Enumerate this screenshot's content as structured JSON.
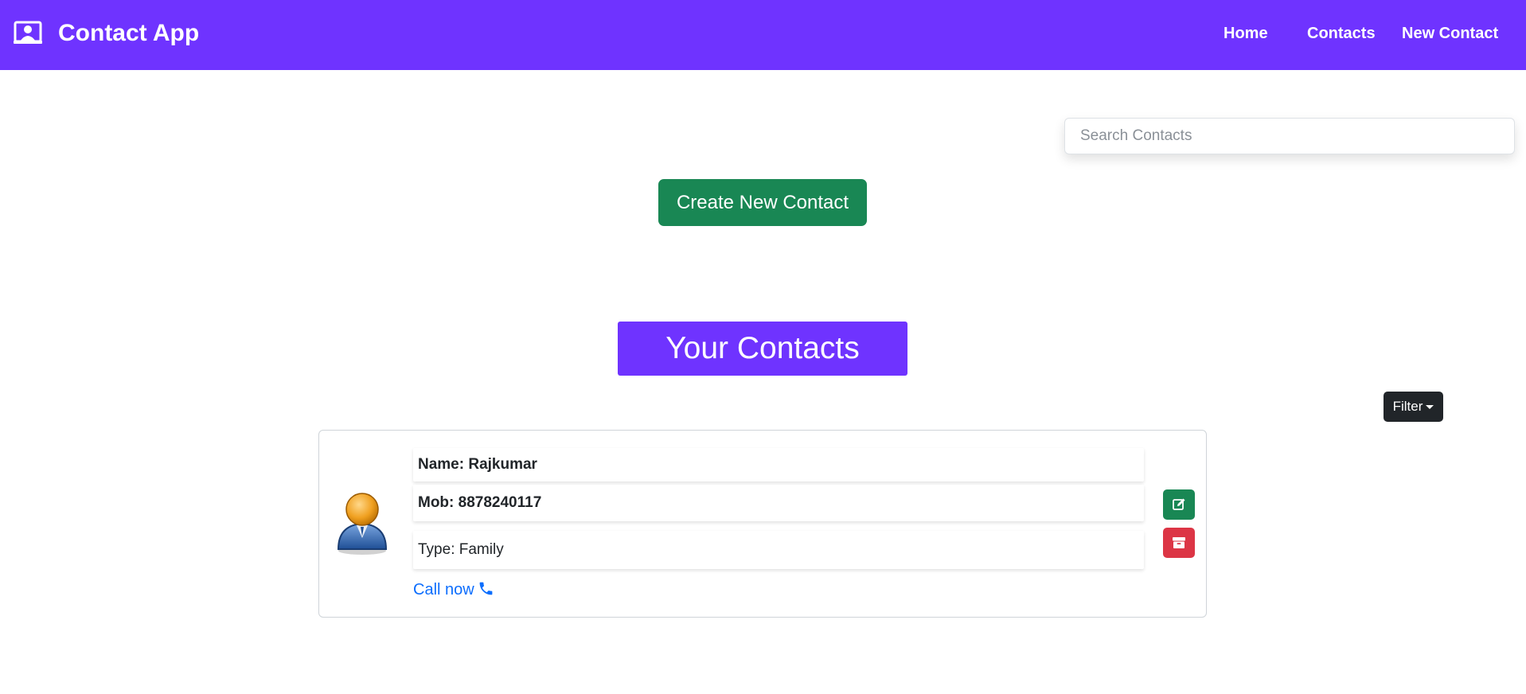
{
  "navbar": {
    "title": "Contact App",
    "brand_icon": "contact-card-icon",
    "links": [
      "Home",
      "Contacts",
      "New Contact"
    ],
    "color": "#6f33ff"
  },
  "search": {
    "placeholder": "Search Contacts"
  },
  "create_button": {
    "label": "Create New Contact",
    "color": "#198754"
  },
  "heading": "Your Contacts",
  "filter": {
    "label": "Filter",
    "color": "#212529"
  },
  "contacts": [
    {
      "name": "Name: Rajkumar",
      "mobile": "Mob: 8878240117",
      "type": "Type: Family",
      "call_label": "Call now",
      "call_icon": "phone-icon",
      "edit_icon": "edit-icon",
      "delete_icon": "archive-icon",
      "avatar_icon": "user-avatar-icon"
    }
  ],
  "colors": {
    "accent": "#6f33ff",
    "success": "#198754",
    "danger": "#dc3545",
    "link": "#0d6efd"
  }
}
